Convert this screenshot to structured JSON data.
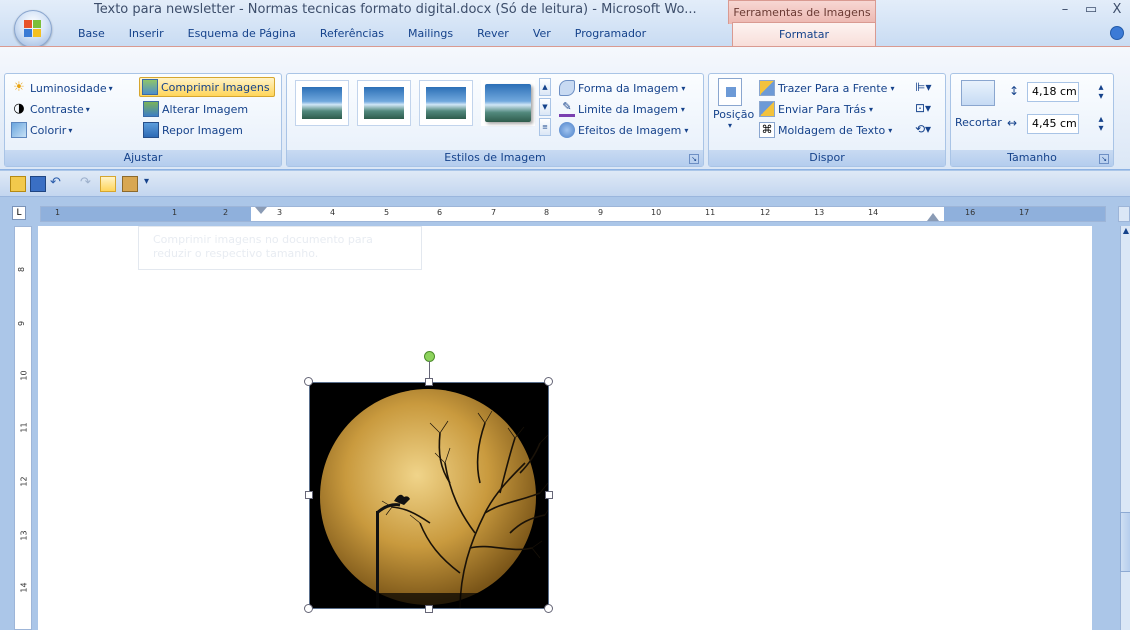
{
  "window": {
    "title": "Texto para newsletter - Normas tecnicas formato digital.docx (Só de leitura) - Microsoft Wo...",
    "context_tab": "Ferramentas de Imagens",
    "controls": [
      "–",
      "▭",
      "X"
    ]
  },
  "tabs": [
    "Base",
    "Inserir",
    "Esquema de Página",
    "Referências",
    "Mailings",
    "Rever",
    "Ver",
    "Programador"
  ],
  "active_tab": "Formatar",
  "groups": {
    "ajustar": {
      "label": "Ajustar",
      "luminosidade": "Luminosidade",
      "contraste": "Contraste",
      "colorir": "Colorir",
      "comprimir": "Comprimir Imagens",
      "alterar": "Alterar Imagem",
      "repor": "Repor Imagem"
    },
    "estilos": {
      "label": "Estilos de Imagem",
      "forma": "Forma da Imagem",
      "limite": "Limite da Imagem",
      "efeitos": "Efeitos de Imagem"
    },
    "dispor": {
      "label": "Dispor",
      "posicao": "Posição",
      "trazer": "Trazer Para a Frente",
      "enviar": "Enviar Para Trás",
      "moldagem": "Moldagem de Texto"
    },
    "tamanho": {
      "label": "Tamanho",
      "recortar": "Recortar",
      "height": "4,18 cm",
      "width": "4,45 cm"
    }
  },
  "ruler": {
    "numbers": [
      "1",
      "1",
      "2",
      "3",
      "4",
      "5",
      "6",
      "7",
      "8",
      "9",
      "10",
      "11",
      "12",
      "13",
      "14",
      "16",
      "17"
    ]
  },
  "vruler": {
    "numbers": [
      "8",
      "9",
      "10",
      "11",
      "12",
      "13",
      "14"
    ]
  },
  "tooltip": {
    "line1": "Comprimir imagens no documento para",
    "line2": "reduzir o respectivo tamanho."
  },
  "colors": {
    "ribbon_bg": "#dbe7f6",
    "accent": "#15428b",
    "context_tab": "#ecb7b0",
    "selected_button": "#ffd55a",
    "rotation_handle": "#8dd35c"
  }
}
